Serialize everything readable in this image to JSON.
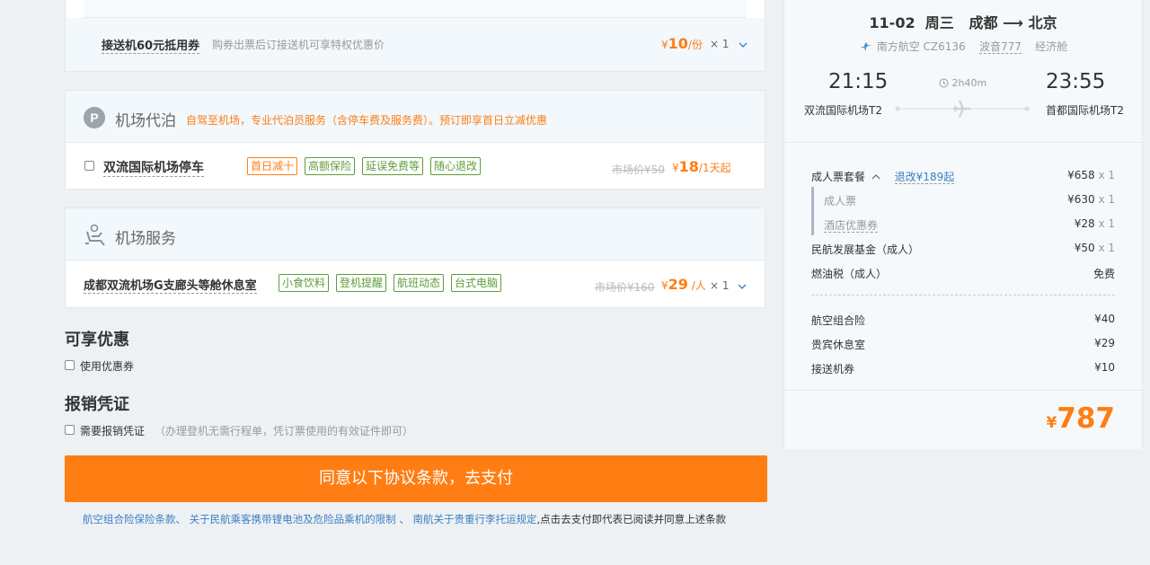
{
  "transfer": {
    "title": "接送机60元抵用券",
    "desc": "购券出票后订接送机可享特权优惠价",
    "currency": "¥",
    "price": "10",
    "unit": "/份",
    "qty": "× 1"
  },
  "parking": {
    "section_title": "机场代泊",
    "section_desc": "自驾至机场，专业代泊员服务（含停车费及服务费）。预订即享首日立减优惠",
    "item_name": "双流国际机场停车",
    "tags": [
      {
        "label": "首日减十",
        "style": "orange"
      },
      {
        "label": "高额保险",
        "style": "green"
      },
      {
        "label": "延误免费等",
        "style": "green"
      },
      {
        "label": "随心退改",
        "style": "green"
      }
    ],
    "market_price": "市场价¥50",
    "currency": "¥",
    "price": "18",
    "unit": "/1天起"
  },
  "lounge": {
    "section_title": "机场服务",
    "item_name": "成都双流机场G支廊头等舱休息室",
    "tags": [
      "小食饮料",
      "登机提醒",
      "航班动态",
      "台式电脑"
    ],
    "market_price": "市场价¥160",
    "currency": "¥",
    "price": "29",
    "unit": "/人",
    "qty": "× 1"
  },
  "discount": {
    "title": "可享优惠",
    "checkbox_label": "使用优惠券"
  },
  "invoice": {
    "title": "报销凭证",
    "checkbox_label": "需要报销凭证",
    "note": "（办理登机无需行程单，凭订票使用的有效证件即可）"
  },
  "pay_button": "同意以下协议条款，去支付",
  "terms": {
    "link1": "航空组合险保险条款",
    "sep1": "、",
    "link2": "关于民航乘客携带锂电池及危险品乘机的限制",
    "sep2": "、",
    "link3": "南航关于贵重行李托运规定",
    "tail": ",点击去支付即代表已阅读并同意上述条款"
  },
  "flight": {
    "date": "11-02",
    "weekday": "周三",
    "from_city": "成都",
    "arrow": "⟶",
    "to_city": "北京",
    "airline": "南方航空 CZ6136",
    "aircraft": "波音777",
    "cabin": "经济舱",
    "dep_time": "21:15",
    "arr_time": "23:55",
    "duration": "2h40m",
    "dep_airport": "双流国际机场T2",
    "arr_airport": "首都国际机场T2"
  },
  "summary": {
    "package_label": "成人票套餐",
    "refund_label": "退改¥189起",
    "package_price": "¥658",
    "x1": "x 1",
    "ticket_label": "成人票",
    "ticket_price": "¥630",
    "hotel_label": "酒店优惠券",
    "hotel_price": "¥28",
    "fund_label": "民航发展基金（成人）",
    "fund_price": "¥50",
    "fuel_label": "燃油税（成人）",
    "fuel_price": "免费",
    "insurance_label": "航空组合险",
    "insurance_price": "¥40",
    "vip_label": "贵宾休息室",
    "vip_price": "¥29",
    "transfer_label": "接送机券",
    "transfer_price": "¥10",
    "total_currency": "¥",
    "total": "787"
  },
  "colors": {
    "accent": "#ff7d13",
    "link": "#3a7fc1",
    "tag_green": "#5f9c3a"
  }
}
